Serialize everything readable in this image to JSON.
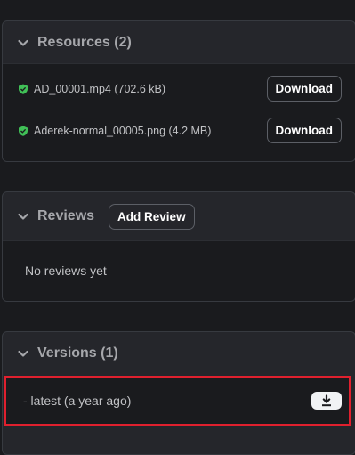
{
  "resources": {
    "title": "Resources (2)",
    "items": [
      {
        "name": "AD_00001.mp4 (702.6 kB)",
        "button": "Download"
      },
      {
        "name": "Aderek-normal_00005.png (4.2 MB)",
        "button": "Download"
      }
    ]
  },
  "reviews": {
    "title": "Reviews",
    "add_button": "Add Review",
    "empty_text": "No reviews yet"
  },
  "versions": {
    "title": "Versions (1)",
    "items": [
      {
        "label": "- latest (a year ago)"
      }
    ]
  },
  "colors": {
    "check": "#40c057",
    "highlight": "#e0202e"
  }
}
